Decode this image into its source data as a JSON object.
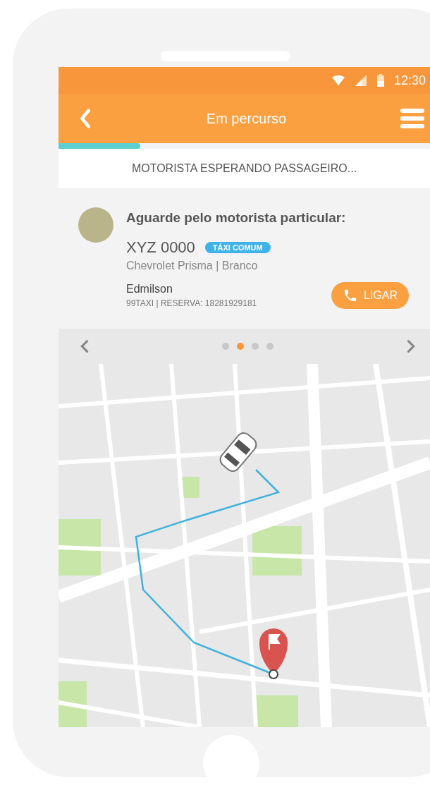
{
  "status_bar": {
    "time": "12:30"
  },
  "header": {
    "title": "Em percurso"
  },
  "progress": {
    "level": 0.22
  },
  "status_message": "MOTORISTA ESPERANDO PASSAGEIRO...",
  "driver_card": {
    "heading": "Aguarde pelo motorista particular:",
    "plate": "XYZ 0000",
    "badge": "TÁXI COMUM",
    "car": "Chevrolet Prisma | Branco",
    "name": "Edmilson",
    "reservation": "99TAXI | RESERVA: 18281929181",
    "call_button": "LIGAR"
  },
  "pager": [
    {
      "selected": false
    },
    {
      "selected": true
    },
    {
      "selected": false
    },
    {
      "selected": false
    }
  ]
}
